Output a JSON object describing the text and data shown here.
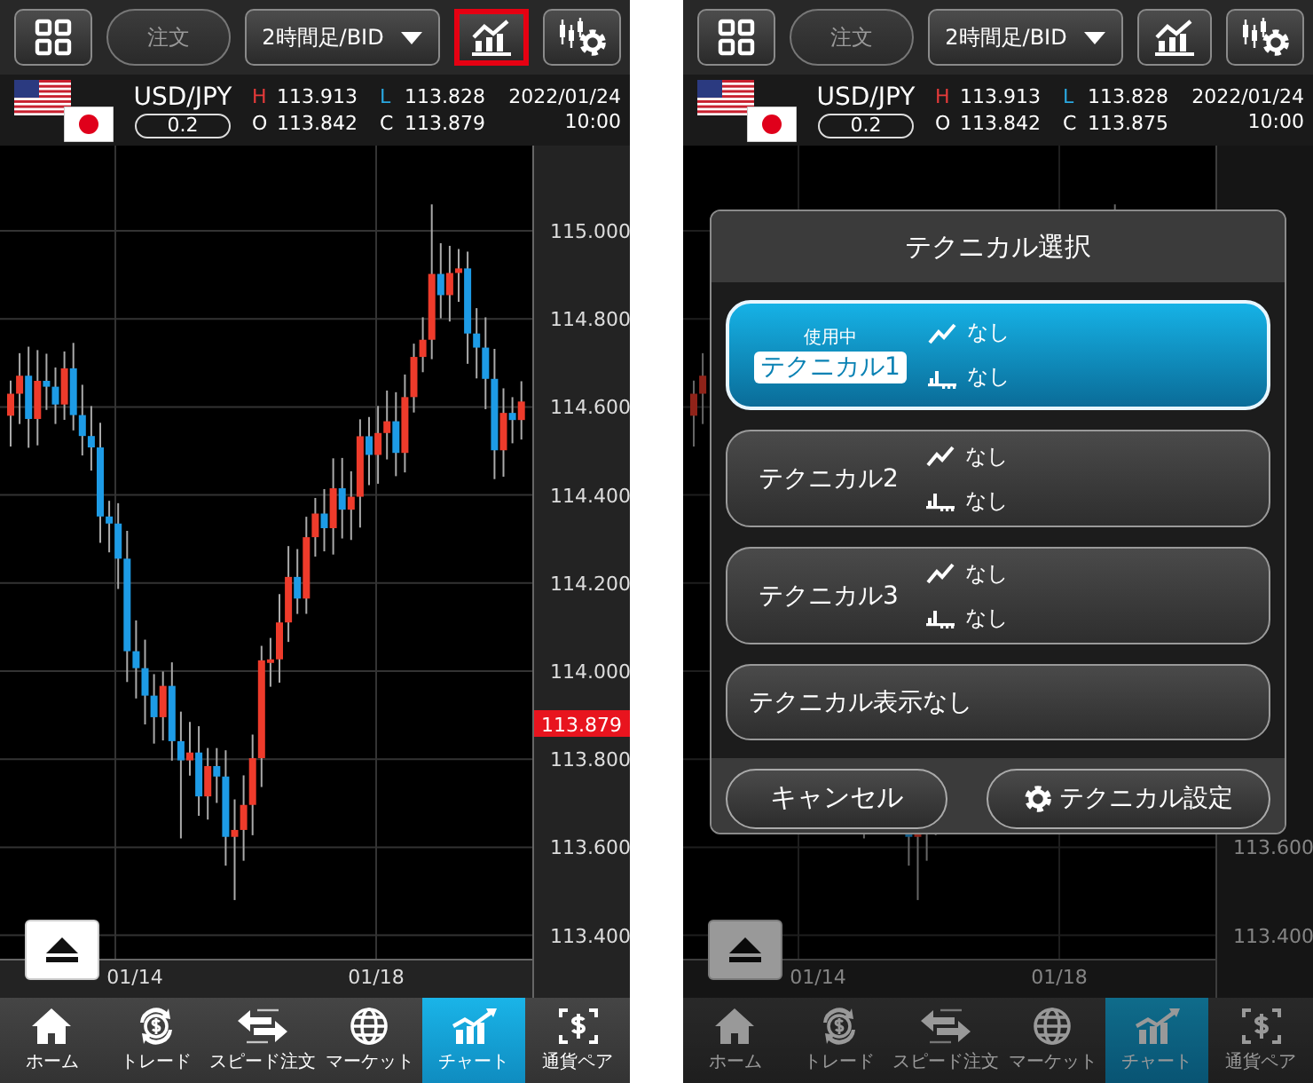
{
  "screens": [
    {
      "toolbar": {
        "order_button": {
          "label": "注文",
          "disabled": true
        },
        "timeframe": "2時間足/BID",
        "chart_button_highlighted": true
      },
      "quote": {
        "pair": "USD/JPY",
        "spread": "0.2",
        "high_label": "H",
        "high": "113.913",
        "low_label": "L",
        "low": "113.828",
        "open_label": "O",
        "open": "113.842",
        "close_label": "C",
        "close": "113.879",
        "date": "2022/01/24",
        "time": "10:00"
      },
      "chart": {
        "price_labels": [
          "115.000",
          "114.800",
          "114.600",
          "114.400",
          "114.200",
          "114.000",
          "113.800",
          "113.600",
          "113.400"
        ],
        "current_price": "113.879",
        "date_labels": [
          "01/14",
          "01/18"
        ]
      },
      "nav": [
        {
          "label": "ホーム",
          "selected": false
        },
        {
          "label": "トレード",
          "selected": false
        },
        {
          "label": "スピード注文",
          "selected": false
        },
        {
          "label": "マーケット",
          "selected": false
        },
        {
          "label": "チャート",
          "selected": true
        },
        {
          "label": "通貨ペア",
          "selected": false
        }
      ]
    },
    {
      "toolbar": {
        "order_button": {
          "label": "注文",
          "disabled": true
        },
        "timeframe": "2時間足/BID",
        "chart_button_highlighted": false
      },
      "quote": {
        "pair": "USD/JPY",
        "spread": "0.2",
        "high_label": "H",
        "high": "113.913",
        "low_label": "L",
        "low": "113.828",
        "open_label": "O",
        "open": "113.842",
        "close_label": "C",
        "close": "113.875",
        "date": "2022/01/24",
        "time": "10:00"
      },
      "chart": {
        "price_labels": [
          "113.600",
          "113.400"
        ],
        "date_labels": [
          "01/14",
          "01/18"
        ]
      },
      "nav": [
        {
          "label": "ホーム",
          "selected": false
        },
        {
          "label": "トレード",
          "selected": false
        },
        {
          "label": "スピード注文",
          "selected": false
        },
        {
          "label": "マーケット",
          "selected": false
        },
        {
          "label": "チャート",
          "selected": true
        },
        {
          "label": "通貨ペア",
          "selected": false
        }
      ],
      "dialog": {
        "title": "テクニカル選択",
        "options": [
          {
            "label": "テクニカル1",
            "selected": true,
            "badge": "使用中",
            "indicators": [
              {
                "kind": "trend",
                "value": "なし"
              },
              {
                "kind": "oscillator",
                "value": "なし"
              }
            ]
          },
          {
            "label": "テクニカル2",
            "selected": false,
            "indicators": [
              {
                "kind": "trend",
                "value": "なし"
              },
              {
                "kind": "oscillator",
                "value": "なし"
              }
            ]
          },
          {
            "label": "テクニカル3",
            "selected": false,
            "indicators": [
              {
                "kind": "trend",
                "value": "なし"
              },
              {
                "kind": "oscillator",
                "value": "なし"
              }
            ]
          },
          {
            "label": "テクニカル表示なし",
            "selected": false
          }
        ],
        "cancel_button": "キャンセル",
        "settings_button": "テクニカル設定"
      }
    }
  ]
}
